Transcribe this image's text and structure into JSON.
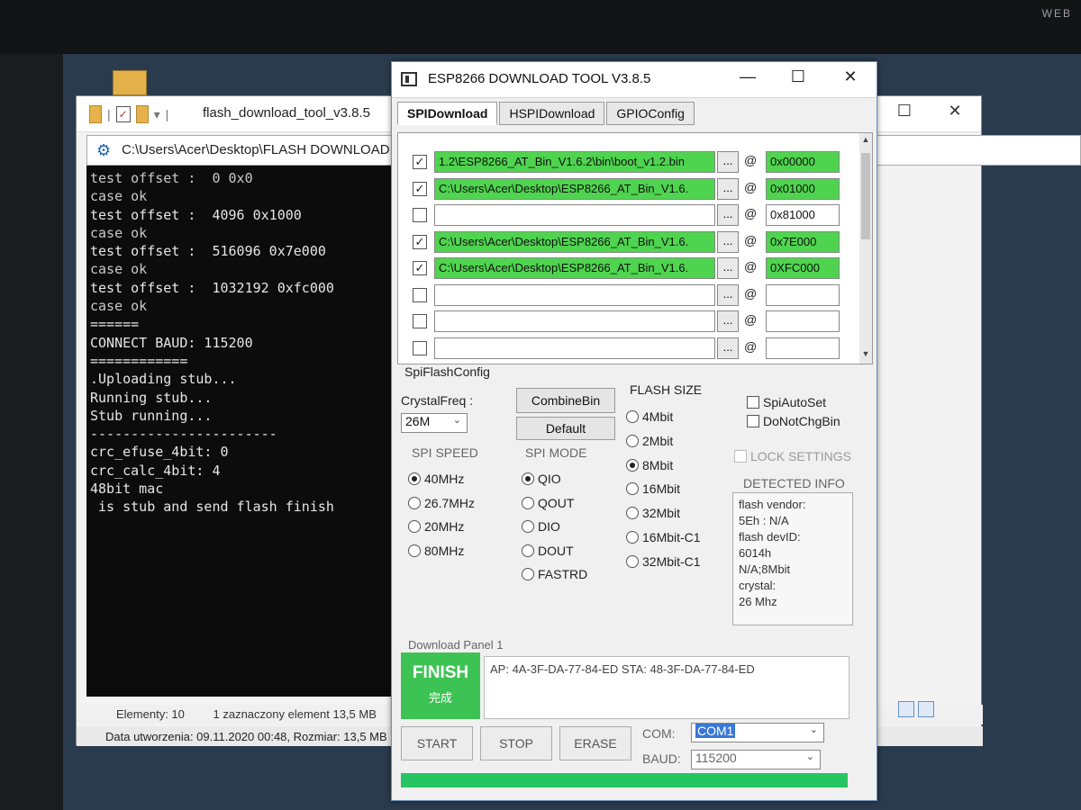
{
  "desktop": {
    "corner_text": "WEB"
  },
  "explorer": {
    "title": "flash_download_tool_v3.8.5",
    "status_elements": "Elementy: 10",
    "status_selected": "1 zaznaczony element 13,5 MB",
    "details": "Data utworzenia: 09.11.2020 00:48, Rozmiar: 13,5 MB"
  },
  "console": {
    "title": "C:\\Users\\Acer\\Desktop\\FLASH DOWNLOAD",
    "lines": [
      "test offset :  0 0x0",
      "case ok",
      "test offset :  4096 0x1000",
      "case ok",
      "test offset :  516096 0x7e000",
      "case ok",
      "test offset :  1032192 0xfc000",
      "case ok",
      "======",
      "CONNECT BAUD: 115200",
      "============",
      ".Uploading stub...",
      "Running stub...",
      "Stub running...",
      "-----------------------",
      "crc_efuse_4bit: 0",
      "crc_calc_4bit: 4",
      "48bit mac",
      "",
      " is stub and send flash finish"
    ]
  },
  "esp": {
    "title": "ESP8266 DOWNLOAD TOOL V3.8.5",
    "tabs": [
      "SPIDownload",
      "HSPIDownload",
      "GPIOConfig"
    ],
    "files": [
      {
        "checked": true,
        "path": "1.2\\ESP8266_AT_Bin_V1.6.2\\bin\\boot_v1.2.bin",
        "addr": "0x00000",
        "green": true
      },
      {
        "checked": true,
        "path": "C:\\Users\\Acer\\Desktop\\ESP8266_AT_Bin_V1.6.",
        "addr": "0x01000",
        "green": true
      },
      {
        "checked": false,
        "path": "",
        "addr": "0x81000",
        "green": false
      },
      {
        "checked": true,
        "path": "C:\\Users\\Acer\\Desktop\\ESP8266_AT_Bin_V1.6.",
        "addr": "0x7E000",
        "green": true
      },
      {
        "checked": true,
        "path": "C:\\Users\\Acer\\Desktop\\ESP8266_AT_Bin_V1.6.",
        "addr": "0XFC000",
        "green": true
      },
      {
        "checked": false,
        "path": "",
        "addr": "",
        "green": false
      },
      {
        "checked": false,
        "path": "",
        "addr": "",
        "green": false
      },
      {
        "checked": false,
        "path": "",
        "addr": "",
        "green": false
      }
    ],
    "browse_label": "...",
    "at_label": "@",
    "spi_flash_config": "SpiFlashConfig",
    "crystal_freq_label": "CrystalFreq :",
    "crystal_freq_value": "26M",
    "combine_bin": "CombineBin",
    "default_btn": "Default",
    "flash_size_label": "FLASH SIZE",
    "flash_sizes": [
      "4Mbit",
      "2Mbit",
      "8Mbit",
      "16Mbit",
      "32Mbit",
      "16Mbit-C1",
      "32Mbit-C1"
    ],
    "flash_size_selected": 2,
    "spi_speed_label": "SPI SPEED",
    "spi_speeds": [
      "40MHz",
      "26.7MHz",
      "20MHz",
      "80MHz"
    ],
    "spi_speed_selected": 0,
    "spi_mode_label": "SPI MODE",
    "spi_modes": [
      "QIO",
      "QOUT",
      "DIO",
      "DOUT",
      "FASTRD"
    ],
    "spi_mode_selected": 0,
    "spi_auto_set": "SpiAutoSet",
    "do_not_chg_bin": "DoNotChgBin",
    "lock_settings": "LOCK SETTINGS",
    "detected_info_label": "DETECTED INFO",
    "detected_info": [
      "flash vendor:",
      "5Eh : N/A",
      "flash devID:",
      "6014h",
      "N/A;8Mbit",
      "crystal:",
      "26 Mhz"
    ],
    "download_panel_label": "Download Panel 1",
    "finish_en": "FINISH",
    "finish_cn": "完成",
    "mac_text": "AP:  4A-3F-DA-77-84-ED  STA:  48-3F-DA-77-84-ED",
    "start": "START",
    "stop": "STOP",
    "erase": "ERASE",
    "com_label": "COM:",
    "com_value": "COM1",
    "baud_label": "BAUD:",
    "baud_value": "115200",
    "progress": 1.0,
    "colors": {
      "green": "#4fd44f",
      "finish": "#3dc354",
      "progress": "#27c562"
    }
  }
}
